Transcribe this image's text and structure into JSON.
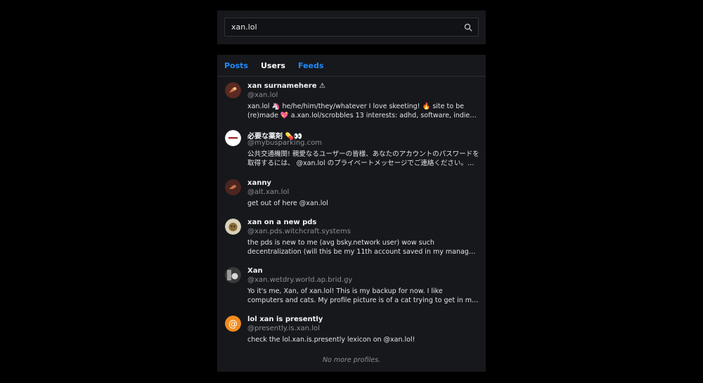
{
  "search": {
    "value": "xan.lol"
  },
  "tabs": [
    {
      "label": "Posts"
    },
    {
      "label": "Users"
    },
    {
      "label": "Feeds"
    }
  ],
  "profiles": [
    {
      "name": "xan surnamehere ⚠",
      "handle": "@xan.lol",
      "description": "xan.lol 🦄 he/he/him/they/whatever I love skeeting! 🔥 site to be (re)made 💖 a.xan.lol/scrobbles 13 interests: adhd, software, indie web..."
    },
    {
      "name": "必要な薬剤 💊👀",
      "handle": "@mybusparking.com",
      "description": "公共交通機関! 親愛なるユーザーの皆様、あなたのアカウントのパスワードを取得するには、 @xan.lol のプライベートメッセージでご連絡ください。必要な..."
    },
    {
      "name": "xanny",
      "handle": "@alt.xan.lol",
      "description": "get out of here @xan.lol"
    },
    {
      "name": "xan on a new pds",
      "handle": "@xan.pds.witchcraft.systems",
      "description": "the pds is new to me (avg bsky.network user) wow such decentralization (will this be my 11th account saved in my manager) follow me..."
    },
    {
      "name": "Xan",
      "handle": "@xan.wetdry.world.ap.brid.gy",
      "description": "Yo it's me, Xan, of xan.lol! This is my backup for now. I like computers and cats. My profile picture is of a cat trying to get in my house, lookin..."
    },
    {
      "name": "lol xan is presently",
      "handle": "@presently.is.xan.lol",
      "description": "check the lol.xan.is.presently lexicon on @xan.lol!"
    }
  ],
  "footer": "No more profiles."
}
